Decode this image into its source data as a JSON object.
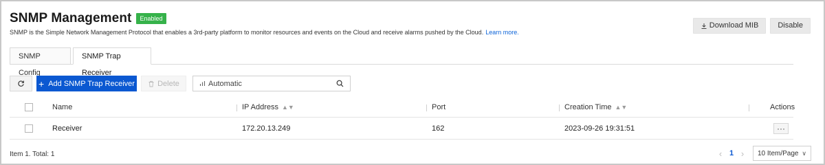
{
  "header": {
    "title": "SNMP Management",
    "status_badge": "Enabled",
    "description": "SNMP is the Simple Network Management Protocol that enables a 3rd-party platform to monitor resources and events on the Cloud and receive alarms pushed by the Cloud.",
    "learn_more": "Learn more.",
    "download_mib_label": "Download MIB",
    "disable_label": "Disable"
  },
  "tabs": [
    {
      "label": "SNMP Config",
      "active": false
    },
    {
      "label": "SNMP Trap Receiver",
      "active": true
    }
  ],
  "toolbar": {
    "refresh_icon": "refresh-icon",
    "add_label": "Add SNMP Trap Receiver",
    "delete_label": "Delete",
    "search_value": "Automatic",
    "search_icon": "search-icon"
  },
  "table": {
    "columns": [
      "Name",
      "IP Address",
      "Port",
      "Creation Time",
      "Actions"
    ],
    "rows": [
      {
        "name": "Receiver",
        "ip": "172.20.13.249",
        "port": "162",
        "created": "2023-09-26 19:31:51",
        "actions": "···"
      }
    ]
  },
  "footer": {
    "summary": "Item 1. Total: 1",
    "current_page": "1",
    "page_size": "10 Item/Page"
  },
  "colors": {
    "accent": "#0b58d1",
    "badge_green": "#36b24a",
    "link": "#0b63d8"
  }
}
